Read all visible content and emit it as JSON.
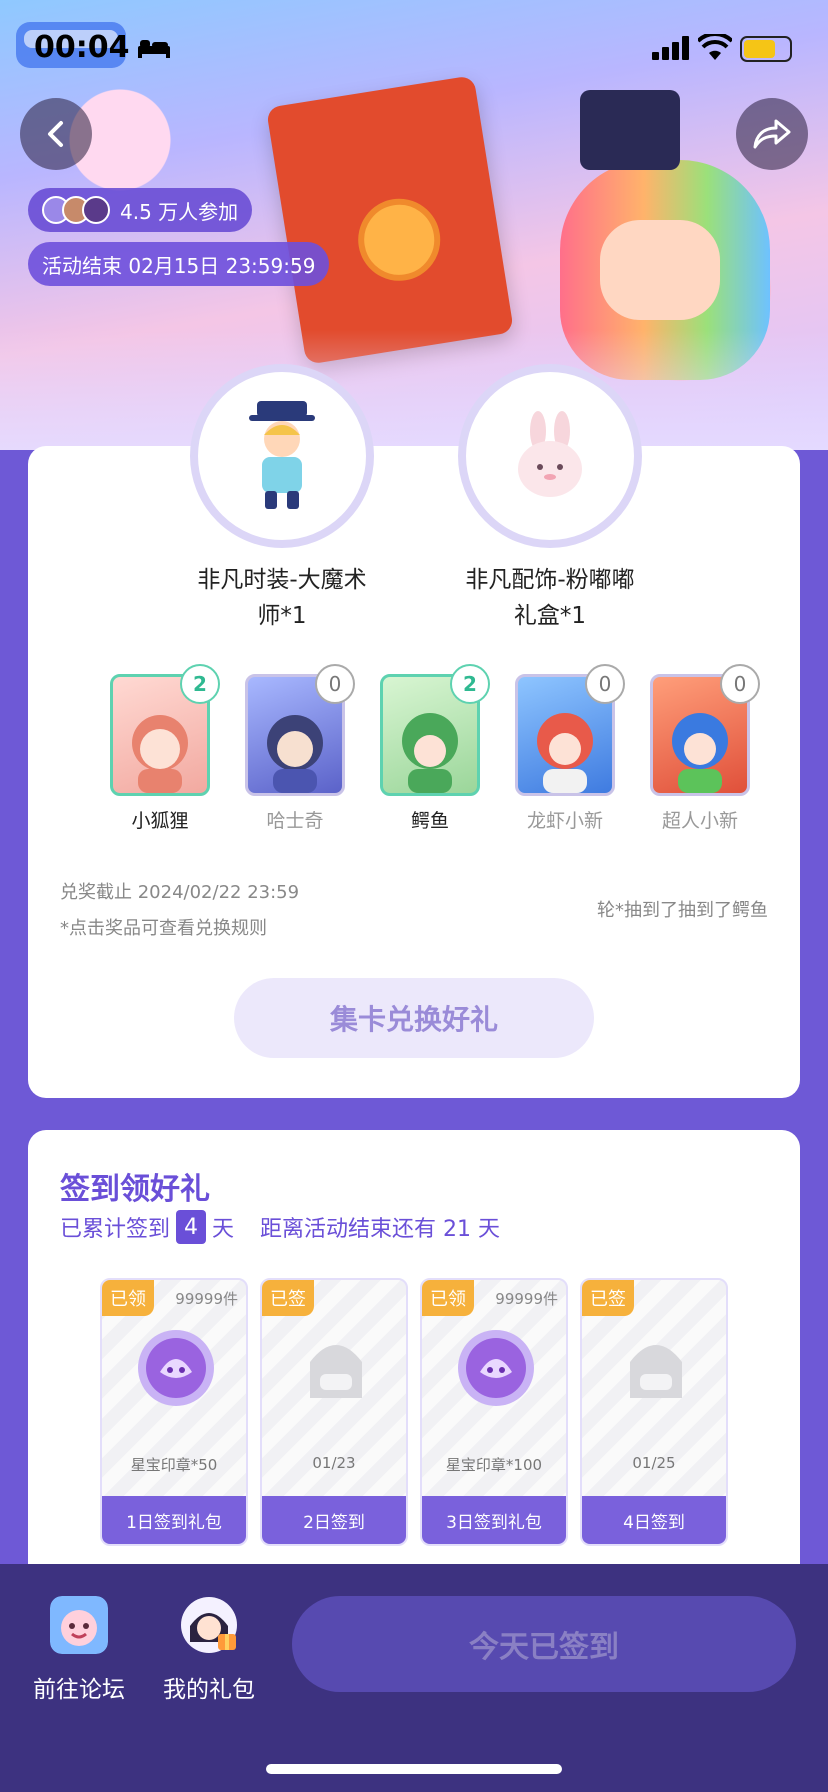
{
  "status_bar": {
    "time": "00:04"
  },
  "header": {
    "participants": "4.5 万人参加",
    "countdown": "活动结束 02月15日 23:59:59"
  },
  "rewards": [
    {
      "name": "非凡时装-大魔术师*1"
    },
    {
      "name": "非凡配饰-粉嘟嘟礼盒*1"
    }
  ],
  "cards": [
    {
      "name": "小狐狸",
      "count": "2",
      "collected": true,
      "color": "#f2a9a0"
    },
    {
      "name": "哈士奇",
      "count": "0",
      "collected": false,
      "color": "#5b62c9"
    },
    {
      "name": "鳄鱼",
      "count": "2",
      "collected": true,
      "color": "#9bd69a"
    },
    {
      "name": "龙虾小新",
      "count": "0",
      "collected": false,
      "color": "#e85a4a"
    },
    {
      "name": "超人小新",
      "count": "0",
      "collected": false,
      "color": "#f07050"
    }
  ],
  "exchange": {
    "deadline": "兑奖截止 2024/02/22 23:59",
    "rule_tip": "*点击奖品可查看兑换规则",
    "ticker": "轮*抽到了抽到了鳄鱼",
    "button": "集卡兑换好礼"
  },
  "signin": {
    "title": "签到领好礼",
    "accumulated_prefix": "已累计签到",
    "days": "4",
    "days_unit": "天",
    "remaining": "距离活动结束还有 21 天",
    "days_list": [
      {
        "tag": "已领",
        "stock": "99999件",
        "caption": "星宝印章*50",
        "foot": "1日签到礼包",
        "icon": "stamp"
      },
      {
        "tag": "已签",
        "stock": "",
        "caption": "01/23",
        "foot": "2日签到",
        "icon": "placeholder"
      },
      {
        "tag": "已领",
        "stock": "99999件",
        "caption": "星宝印章*100",
        "foot": "3日签到礼包",
        "icon": "stamp"
      },
      {
        "tag": "已签",
        "stock": "",
        "caption": "01/25",
        "foot": "4日签到",
        "icon": "placeholder"
      }
    ]
  },
  "bottom_nav": {
    "forum": "前往论坛",
    "gifts": "我的礼包",
    "checkin": "今天已签到"
  },
  "colors": {
    "accent": "#6a4fd8",
    "background": "#6e59d6",
    "collected": "#5ed2b0",
    "tag": "#f6b13c"
  }
}
